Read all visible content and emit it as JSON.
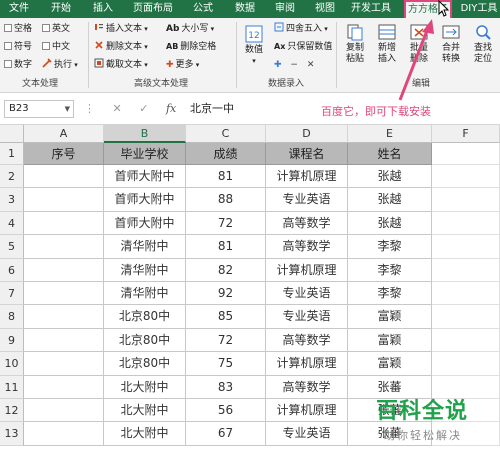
{
  "ribbon_tabs": [
    "文件",
    "开始",
    "插入",
    "页面布局",
    "公式",
    "数据",
    "审阅",
    "视图",
    "开发工具",
    "方方格子",
    "DIY工具"
  ],
  "active_tab": "方方格子",
  "text_group": {
    "checks": [
      "空格",
      "英文",
      "符号",
      "中文",
      "数字"
    ],
    "exec_label": "执行",
    "label": "文本处理"
  },
  "advanced_group": {
    "items": [
      "插入文本",
      "删除文本",
      "截取文本"
    ],
    "case_items": [
      "大小写",
      "删除空格",
      "更多"
    ],
    "label": "高级文本处理"
  },
  "number_group": {
    "big_label": "数值",
    "items": [
      "四舍五入",
      "只保留数值"
    ],
    "label": "数据录入"
  },
  "edit_group": {
    "buttons": [
      "复制粘贴",
      "新增插入",
      "批量删除",
      "合并转换",
      "查找定位"
    ],
    "label": "编辑"
  },
  "formula_bar": {
    "name_box": "B23",
    "content": "北京一中"
  },
  "annotation": "百度它，即可下载安装",
  "columns": [
    "A",
    "B",
    "C",
    "D",
    "E",
    "F"
  ],
  "selected_column": "B",
  "row_numbers": [
    "1",
    "2",
    "3",
    "4",
    "5",
    "6",
    "7",
    "8",
    "9",
    "10",
    "11",
    "12",
    "13"
  ],
  "table": {
    "headers": [
      "序号",
      "毕业学校",
      "成绩",
      "课程名",
      "姓名"
    ],
    "rows": [
      [
        "",
        "首师大附中",
        "81",
        "计算机原理",
        "张越"
      ],
      [
        "",
        "首师大附中",
        "88",
        "专业英语",
        "张越"
      ],
      [
        "",
        "首师大附中",
        "72",
        "高等数学",
        "张越"
      ],
      [
        "",
        "清华附中",
        "81",
        "高等数学",
        "李黎"
      ],
      [
        "",
        "清华附中",
        "82",
        "计算机原理",
        "李黎"
      ],
      [
        "",
        "清华附中",
        "92",
        "专业英语",
        "李黎"
      ],
      [
        "",
        "北京80中",
        "85",
        "专业英语",
        "富颖"
      ],
      [
        "",
        "北京80中",
        "72",
        "高等数学",
        "富颖"
      ],
      [
        "",
        "北京80中",
        "75",
        "计算机原理",
        "富颖"
      ],
      [
        "",
        "北大附中",
        "83",
        "高等数学",
        "张蕃"
      ],
      [
        "",
        "北大附中",
        "56",
        "计算机原理",
        "张蕃"
      ],
      [
        "",
        "北大附中",
        "67",
        "专业英语",
        "张蕃"
      ]
    ]
  },
  "watermark": {
    "title": "百科全说",
    "subtitle": "助你轻松解决"
  },
  "colors": {
    "ribbon_green": "#217346",
    "accent_pink": "#e0457b",
    "header_gray": "#b8b8b8",
    "watermark_green": "#1fa24a"
  }
}
